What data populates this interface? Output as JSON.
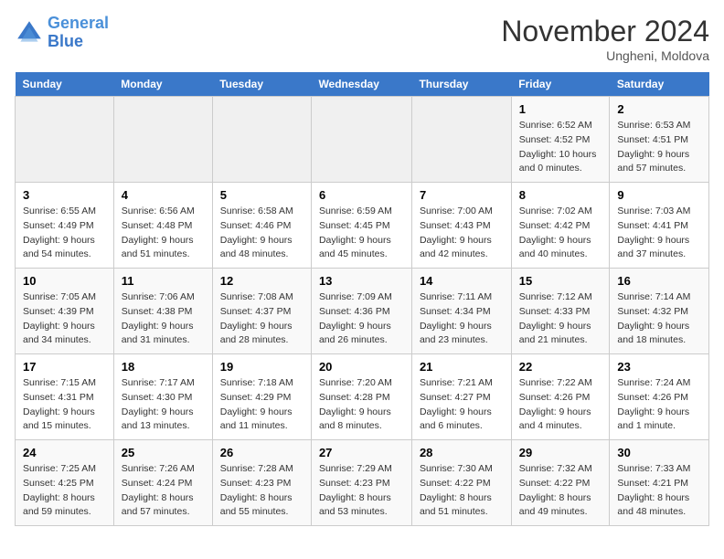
{
  "logo": {
    "line1": "General",
    "line2": "Blue"
  },
  "title": "November 2024",
  "location": "Ungheni, Moldova",
  "days_of_week": [
    "Sunday",
    "Monday",
    "Tuesday",
    "Wednesday",
    "Thursday",
    "Friday",
    "Saturday"
  ],
  "weeks": [
    [
      {
        "day": "",
        "info": ""
      },
      {
        "day": "",
        "info": ""
      },
      {
        "day": "",
        "info": ""
      },
      {
        "day": "",
        "info": ""
      },
      {
        "day": "",
        "info": ""
      },
      {
        "day": "1",
        "info": "Sunrise: 6:52 AM\nSunset: 4:52 PM\nDaylight: 10 hours\nand 0 minutes."
      },
      {
        "day": "2",
        "info": "Sunrise: 6:53 AM\nSunset: 4:51 PM\nDaylight: 9 hours\nand 57 minutes."
      }
    ],
    [
      {
        "day": "3",
        "info": "Sunrise: 6:55 AM\nSunset: 4:49 PM\nDaylight: 9 hours\nand 54 minutes."
      },
      {
        "day": "4",
        "info": "Sunrise: 6:56 AM\nSunset: 4:48 PM\nDaylight: 9 hours\nand 51 minutes."
      },
      {
        "day": "5",
        "info": "Sunrise: 6:58 AM\nSunset: 4:46 PM\nDaylight: 9 hours\nand 48 minutes."
      },
      {
        "day": "6",
        "info": "Sunrise: 6:59 AM\nSunset: 4:45 PM\nDaylight: 9 hours\nand 45 minutes."
      },
      {
        "day": "7",
        "info": "Sunrise: 7:00 AM\nSunset: 4:43 PM\nDaylight: 9 hours\nand 42 minutes."
      },
      {
        "day": "8",
        "info": "Sunrise: 7:02 AM\nSunset: 4:42 PM\nDaylight: 9 hours\nand 40 minutes."
      },
      {
        "day": "9",
        "info": "Sunrise: 7:03 AM\nSunset: 4:41 PM\nDaylight: 9 hours\nand 37 minutes."
      }
    ],
    [
      {
        "day": "10",
        "info": "Sunrise: 7:05 AM\nSunset: 4:39 PM\nDaylight: 9 hours\nand 34 minutes."
      },
      {
        "day": "11",
        "info": "Sunrise: 7:06 AM\nSunset: 4:38 PM\nDaylight: 9 hours\nand 31 minutes."
      },
      {
        "day": "12",
        "info": "Sunrise: 7:08 AM\nSunset: 4:37 PM\nDaylight: 9 hours\nand 28 minutes."
      },
      {
        "day": "13",
        "info": "Sunrise: 7:09 AM\nSunset: 4:36 PM\nDaylight: 9 hours\nand 26 minutes."
      },
      {
        "day": "14",
        "info": "Sunrise: 7:11 AM\nSunset: 4:34 PM\nDaylight: 9 hours\nand 23 minutes."
      },
      {
        "day": "15",
        "info": "Sunrise: 7:12 AM\nSunset: 4:33 PM\nDaylight: 9 hours\nand 21 minutes."
      },
      {
        "day": "16",
        "info": "Sunrise: 7:14 AM\nSunset: 4:32 PM\nDaylight: 9 hours\nand 18 minutes."
      }
    ],
    [
      {
        "day": "17",
        "info": "Sunrise: 7:15 AM\nSunset: 4:31 PM\nDaylight: 9 hours\nand 15 minutes."
      },
      {
        "day": "18",
        "info": "Sunrise: 7:17 AM\nSunset: 4:30 PM\nDaylight: 9 hours\nand 13 minutes."
      },
      {
        "day": "19",
        "info": "Sunrise: 7:18 AM\nSunset: 4:29 PM\nDaylight: 9 hours\nand 11 minutes."
      },
      {
        "day": "20",
        "info": "Sunrise: 7:20 AM\nSunset: 4:28 PM\nDaylight: 9 hours\nand 8 minutes."
      },
      {
        "day": "21",
        "info": "Sunrise: 7:21 AM\nSunset: 4:27 PM\nDaylight: 9 hours\nand 6 minutes."
      },
      {
        "day": "22",
        "info": "Sunrise: 7:22 AM\nSunset: 4:26 PM\nDaylight: 9 hours\nand 4 minutes."
      },
      {
        "day": "23",
        "info": "Sunrise: 7:24 AM\nSunset: 4:26 PM\nDaylight: 9 hours\nand 1 minute."
      }
    ],
    [
      {
        "day": "24",
        "info": "Sunrise: 7:25 AM\nSunset: 4:25 PM\nDaylight: 8 hours\nand 59 minutes."
      },
      {
        "day": "25",
        "info": "Sunrise: 7:26 AM\nSunset: 4:24 PM\nDaylight: 8 hours\nand 57 minutes."
      },
      {
        "day": "26",
        "info": "Sunrise: 7:28 AM\nSunset: 4:23 PM\nDaylight: 8 hours\nand 55 minutes."
      },
      {
        "day": "27",
        "info": "Sunrise: 7:29 AM\nSunset: 4:23 PM\nDaylight: 8 hours\nand 53 minutes."
      },
      {
        "day": "28",
        "info": "Sunrise: 7:30 AM\nSunset: 4:22 PM\nDaylight: 8 hours\nand 51 minutes."
      },
      {
        "day": "29",
        "info": "Sunrise: 7:32 AM\nSunset: 4:22 PM\nDaylight: 8 hours\nand 49 minutes."
      },
      {
        "day": "30",
        "info": "Sunrise: 7:33 AM\nSunset: 4:21 PM\nDaylight: 8 hours\nand 48 minutes."
      }
    ]
  ]
}
